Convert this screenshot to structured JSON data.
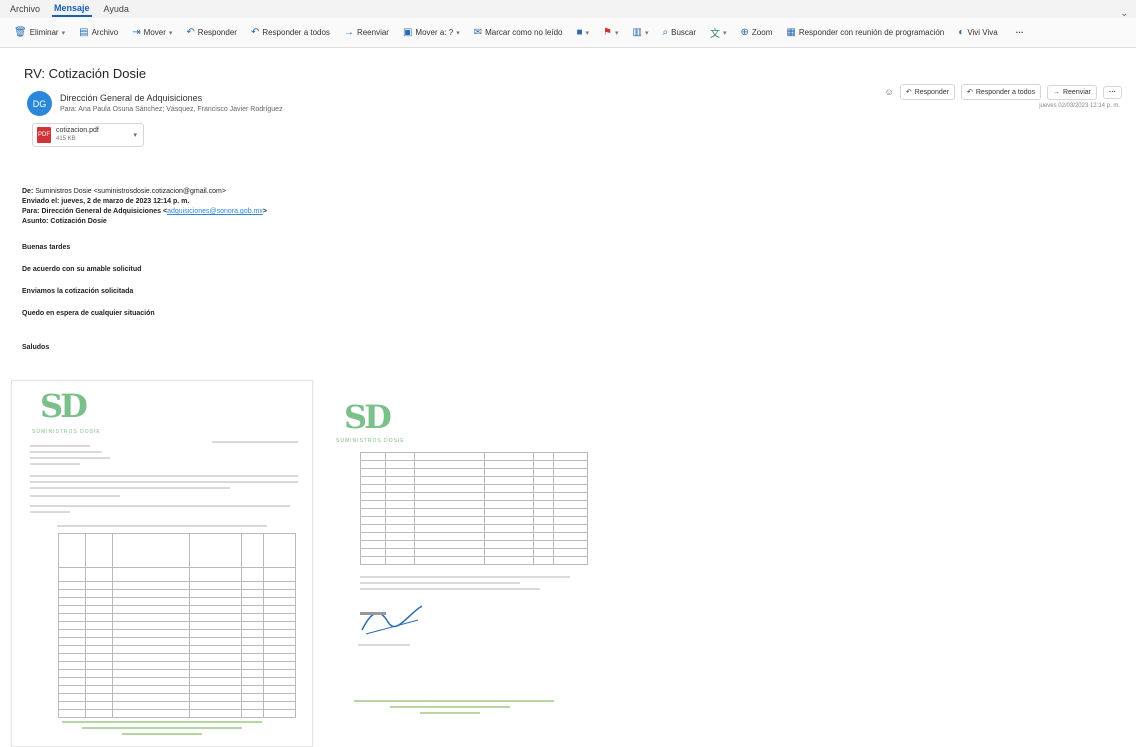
{
  "menu": {
    "items": [
      "Archivo",
      "Mensaje",
      "Ayuda"
    ],
    "active_index": 1
  },
  "ribbon": {
    "buttons": [
      {
        "label": "Eliminar",
        "icon": "trash-icon",
        "caret": true
      },
      {
        "label": "Archivo",
        "icon": "archive-icon",
        "caret": false
      },
      {
        "label": "Mover",
        "icon": "move-icon",
        "caret": true
      },
      {
        "label": "Responder",
        "icon": "reply-icon",
        "caret": false
      },
      {
        "label": "Responder a todos",
        "icon": "reply-all-icon",
        "caret": false
      },
      {
        "label": "Reenviar",
        "icon": "forward-icon",
        "caret": false
      },
      {
        "label": "Mover a: ?",
        "icon": "folder-move-icon",
        "caret": true
      },
      {
        "label": "Marcar como no leído",
        "icon": "mail-unread-icon",
        "caret": false
      },
      {
        "label": "",
        "icon": "category-icon",
        "caret": true
      },
      {
        "label": "",
        "icon": "flag-icon",
        "caret": true
      },
      {
        "label": "",
        "icon": "pin-icon",
        "caret": true
      },
      {
        "label": "Buscar",
        "icon": "search-icon",
        "caret": false
      },
      {
        "label": "",
        "icon": "translate-icon",
        "caret": true
      },
      {
        "label": "Zoom",
        "icon": "zoom-icon",
        "caret": false
      },
      {
        "label": "Responder con reunión de programación",
        "icon": "calendar-reply-icon",
        "caret": false
      },
      {
        "label": "Vivi Viva",
        "icon": "insights-icon",
        "caret": false
      }
    ],
    "more_label": "···",
    "collapse_label": "⌄"
  },
  "message": {
    "subject": "RV: Cotización Dosie",
    "avatar_initials": "DG",
    "sender": "Dirección General de Adquisiciones",
    "recipients": "Para: Ana Paula Osuna Sánchez; Vásquez, Francisco Javier Rodríguez",
    "attachment": {
      "name": "cotizacion.pdf",
      "size": "415 KB"
    },
    "actions": {
      "reply": "Responder",
      "reply_all": "Responder a todos",
      "forward": "Reenviar",
      "more": "···"
    },
    "received": "jueves 02/03/2023 12:14 p. m."
  },
  "body": {
    "from_label": "De:",
    "from_value": "Suministros Dosie <suministrosdosie.cotizacion@gmail.com>",
    "sent_label": "Enviado el:",
    "sent_value": "jueves, 2 de marzo de 2023 12:14 p. m.",
    "to_label": "Para:",
    "to_value": "Dirección General de Adquisiciones <",
    "to_email": "adquisiciones@sonora.gob.mx",
    "to_tail": ">",
    "subject_label": "Asunto:",
    "subject_value": "Cotización Dosie",
    "greeting": "Buenas tardes",
    "line1": "De acuerdo con su amable solicitud",
    "line2": "Enviamos la cotización solicitada",
    "line3": "Quedo en espera de cualquier situación",
    "closing": "Saludos"
  },
  "documents": {
    "logo_text": "SD",
    "logo_sub": "SUMINISTROS DOSIE"
  },
  "colors": {
    "accent": "#1a5fb4",
    "avatar": "#2b88d8",
    "logo_green": "#7bbf8a"
  }
}
